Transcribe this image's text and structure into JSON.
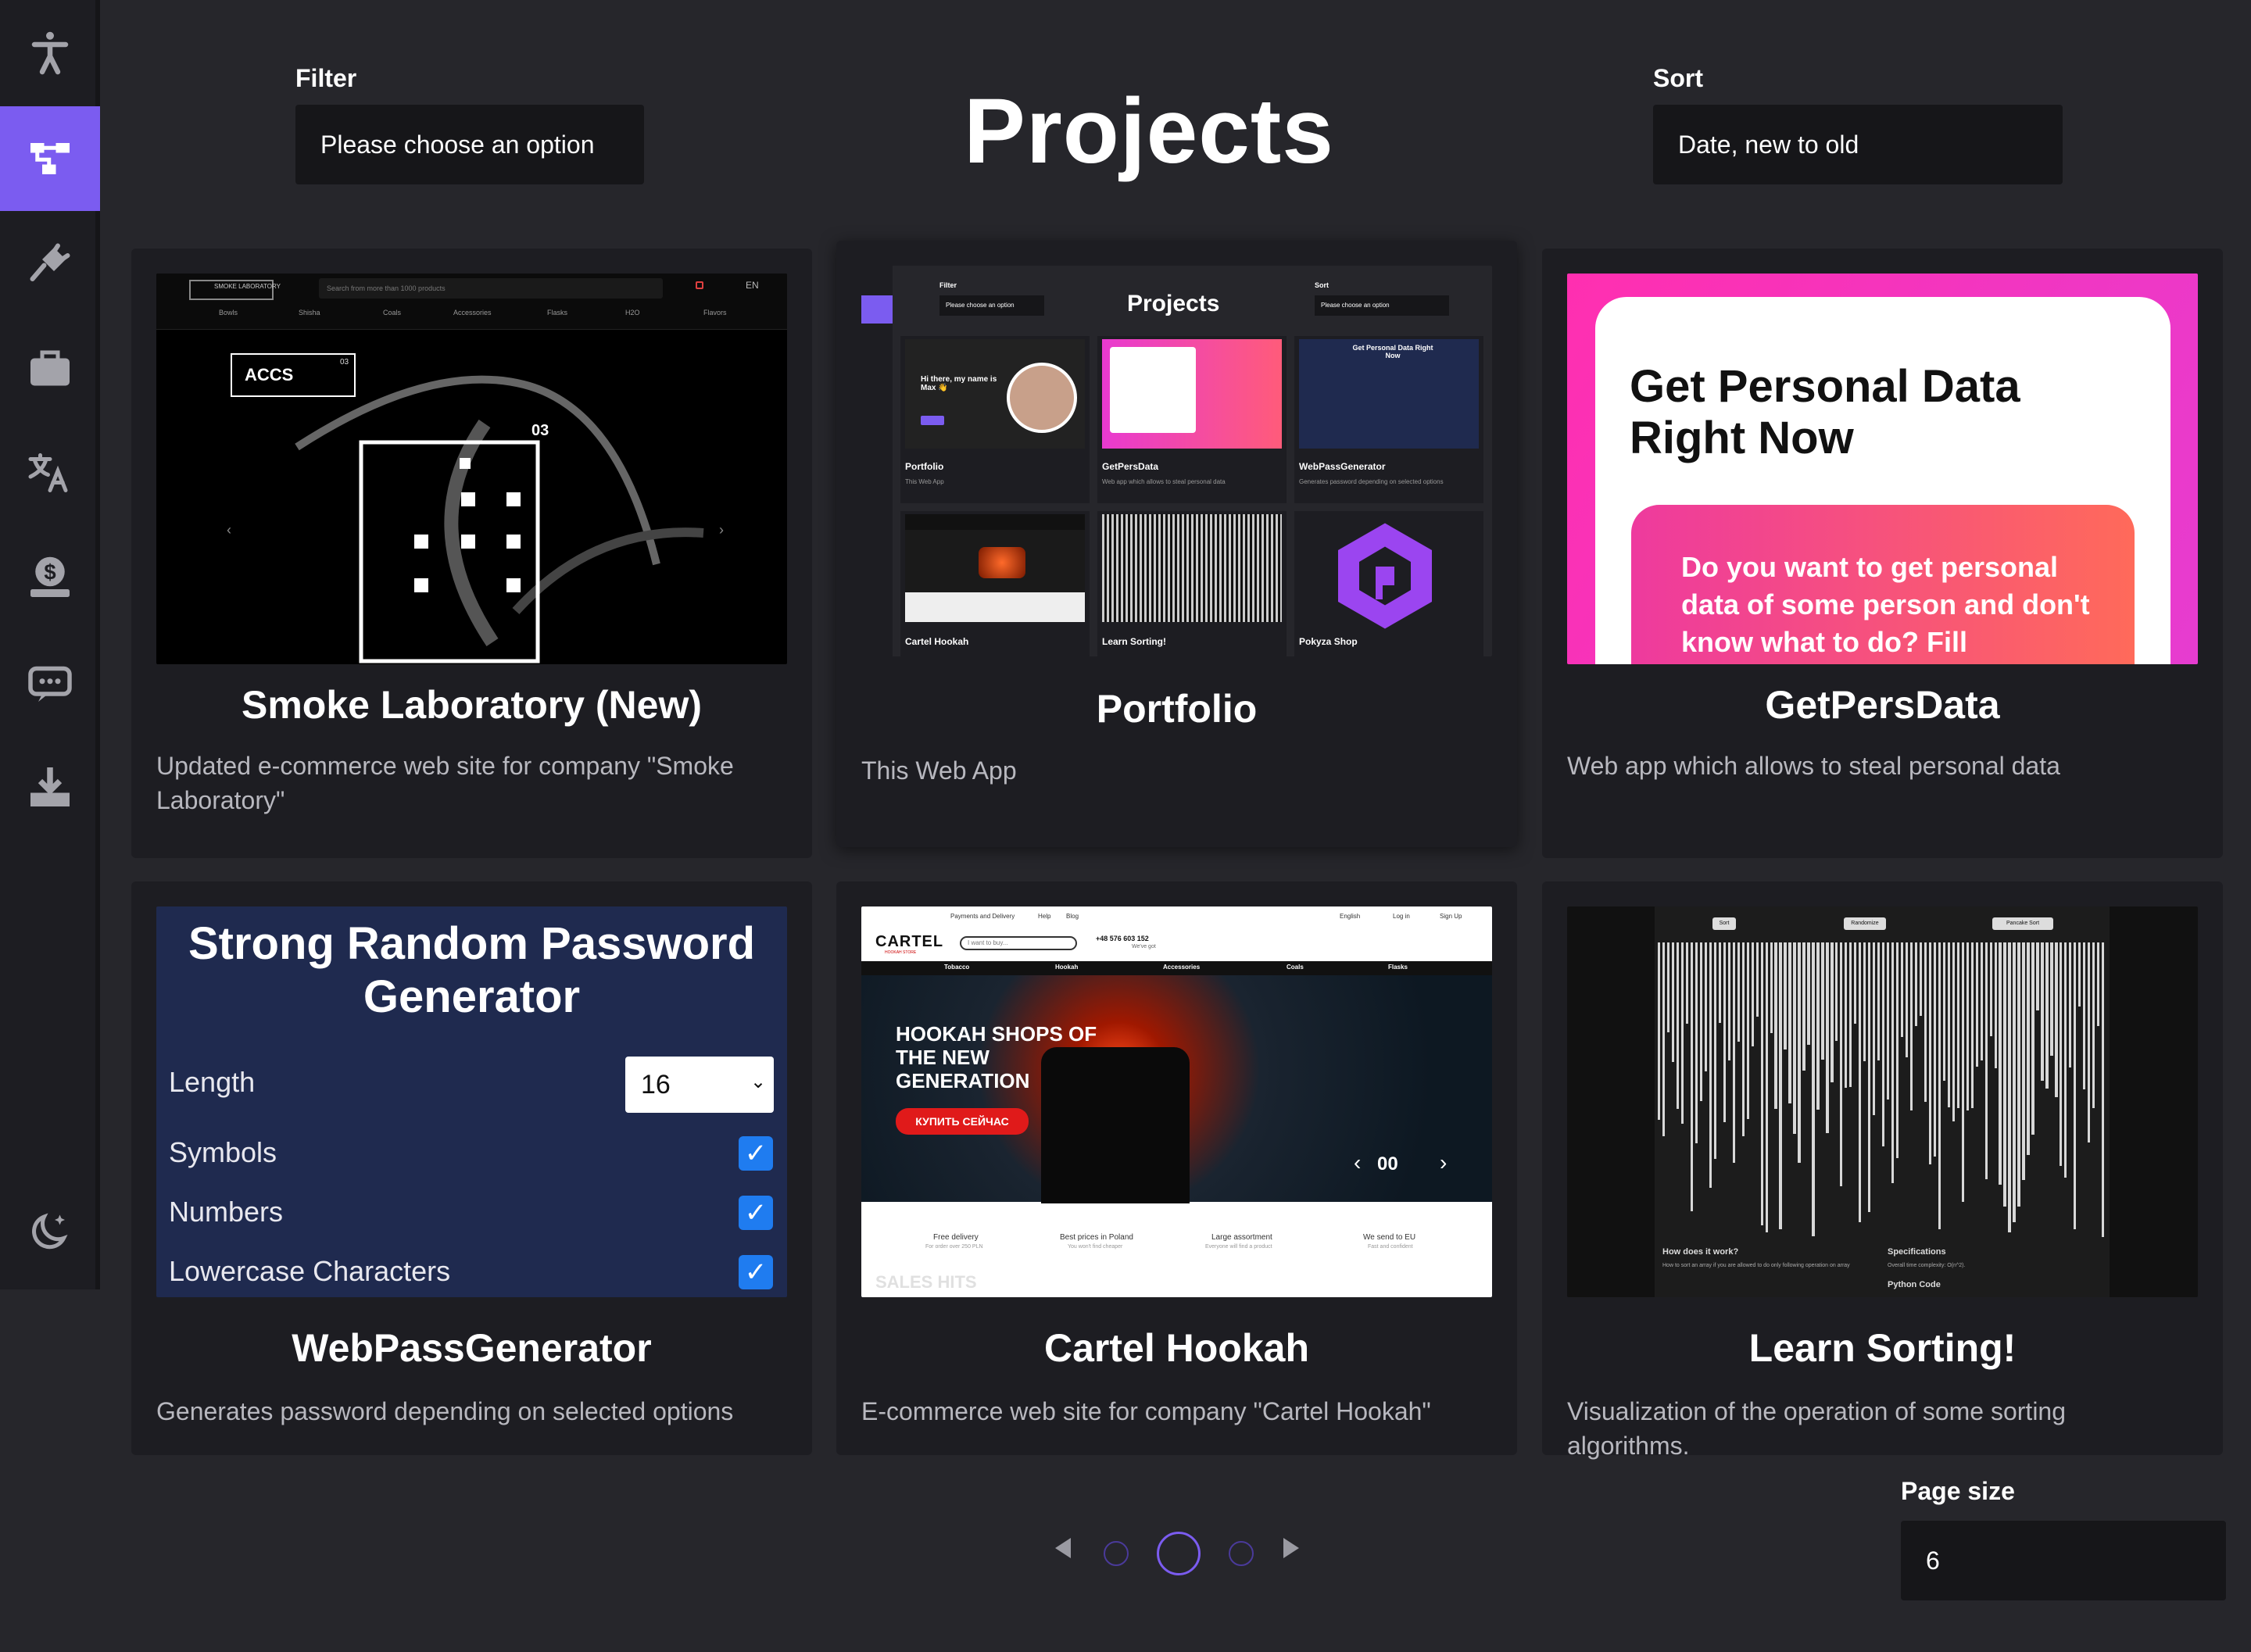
{
  "filter": {
    "label": "Filter",
    "value": "Please choose an option"
  },
  "sort": {
    "label": "Sort",
    "value": "Date, new to old"
  },
  "page_title": "Projects",
  "page_size": {
    "label": "Page size",
    "value": "6"
  },
  "sidebar": {
    "items": [
      {
        "icon": "accessibility-icon"
      },
      {
        "icon": "projects-tree-icon",
        "active": true
      },
      {
        "icon": "plug-icon"
      },
      {
        "icon": "briefcase-icon"
      },
      {
        "icon": "translate-icon"
      },
      {
        "icon": "donate-icon"
      },
      {
        "icon": "message-icon"
      },
      {
        "icon": "download-icon"
      },
      {
        "icon": "theme-moon-icon"
      }
    ]
  },
  "projects": [
    {
      "title": "Smoke Laboratory (New)",
      "desc": "Updated e-commerce web site for company \"Smoke Laboratory\"",
      "thumb": {
        "logo": "SMOKE LABORATORY",
        "search": "Search from more than 1000 products",
        "lang": "EN",
        "nav": [
          "Bowls",
          "Shisha",
          "Coals",
          "Accessories",
          "Flasks",
          "H2O",
          "Flavors"
        ],
        "badge": "ACCS",
        "badge_num": "03",
        "slide": "03"
      }
    },
    {
      "title": "Portfolio",
      "desc": "This Web App",
      "thumb": {
        "title": "Projects",
        "filter_label": "Filter",
        "filter_value": "Please choose an option",
        "sort_label": "Sort",
        "sort_value": "Please choose an option",
        "cards": [
          {
            "name": "Portfolio",
            "desc": "This Web App",
            "greet": "Hi there, my name is Max 👋"
          },
          {
            "name": "GetPersData",
            "desc": "Web app which allows to steal personal data"
          },
          {
            "name": "WebPassGenerator",
            "desc": "Generates password depending on selected options"
          },
          {
            "name": "Cartel Hookah",
            "desc": ""
          },
          {
            "name": "Learn Sorting!",
            "desc": ""
          },
          {
            "name": "Pokyza Shop",
            "desc": ""
          }
        ]
      }
    },
    {
      "title": "GetPersData",
      "desc": "Web app which allows to steal personal data",
      "thumb": {
        "heading": "Get Personal Data Right Now",
        "body": "Do you want to get personal data of some person and don't know what to do? Fill"
      }
    },
    {
      "title": "WebPassGenerator",
      "desc": "Generates password depending on selected options",
      "thumb": {
        "heading": "Strong Random Password Generator",
        "length_label": "Length",
        "length_value": "16",
        "options": [
          "Symbols",
          "Numbers",
          "Lowercase Characters"
        ]
      }
    },
    {
      "title": "Cartel Hookah",
      "desc": "E-commerce web site for company \"Cartel Hookah\"",
      "thumb": {
        "topnav": [
          "Payments and Delivery",
          "Help",
          "Blog"
        ],
        "lang": "English",
        "login": "Log in",
        "signup": "Sign Up",
        "logo": "CARTEL",
        "logo_sub": "HOOKAH STORE",
        "search": "I want to buy...",
        "phone": "+48 576 603 152",
        "phone_sub": "We've got",
        "nav": [
          "Tobacco",
          "Hookah",
          "Accessories",
          "Coals",
          "Flasks"
        ],
        "hero": "HOOKAH SHOPS OF THE NEW GENERATION",
        "cta": "КУПИТЬ СЕЙЧАС",
        "slide": "00",
        "features": [
          {
            "t": "Free delivery",
            "s": "For order over 250 PLN"
          },
          {
            "t": "Best prices in Poland",
            "s": "You won't find cheaper"
          },
          {
            "t": "Large assortment",
            "s": "Everyone will find a product"
          },
          {
            "t": "We send to EU",
            "s": "Fast and confident"
          }
        ],
        "sales": "SALES HITS"
      }
    },
    {
      "title": "Learn Sorting!",
      "desc": "Visualization of the operation of some sorting algorithms.",
      "thumb": {
        "btn_sort": "Sort",
        "btn_random": "Randomize",
        "btn_algo": "Pancake Sort",
        "q": "How does it work?",
        "q_body": "How to sort an array if you are allowed to do only following operation on array",
        "spec": "Specifications",
        "spec_body": "Overall time complexity: O(n^2).",
        "code": "Python Code"
      }
    }
  ],
  "colors": {
    "accent": "#7b5cf0",
    "bg": "#26262b",
    "card": "#1d1d22",
    "input": "#161619"
  },
  "pagination": {
    "pages": 3,
    "current": 2
  }
}
